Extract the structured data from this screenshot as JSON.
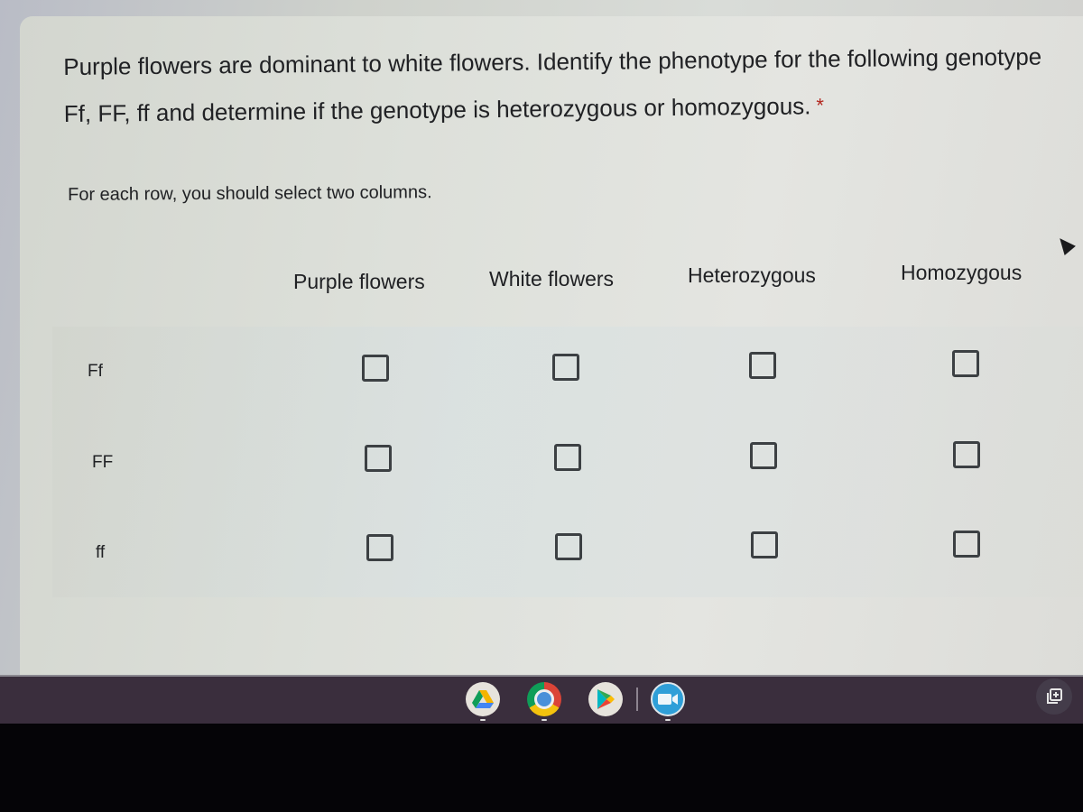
{
  "question": {
    "title": "Purple flowers are dominant to white flowers. Identify the phenotype for the following genotype Ff, FF, ff and determine if the genotype is heterozygous or homozygous.",
    "required_marker": "*",
    "description": "For each row, you should select two columns."
  },
  "grid": {
    "columns": [
      "Purple flowers",
      "White flowers",
      "Heterozygous",
      "Homozygous"
    ],
    "rows": [
      {
        "label": "Ff",
        "checked": [
          false,
          false,
          false,
          false
        ]
      },
      {
        "label": "FF",
        "checked": [
          false,
          false,
          false,
          false
        ]
      },
      {
        "label": "ff",
        "checked": [
          false,
          false,
          false,
          false
        ]
      }
    ]
  },
  "shelf": {
    "apps": [
      {
        "name": "Google Drive",
        "icon": "drive-icon"
      },
      {
        "name": "Chrome",
        "icon": "chrome-icon"
      },
      {
        "name": "Play Store",
        "icon": "play-store-icon"
      },
      {
        "name": "Zoom",
        "icon": "zoom-video-icon"
      }
    ],
    "system_icon": "screen-capture-icon"
  }
}
